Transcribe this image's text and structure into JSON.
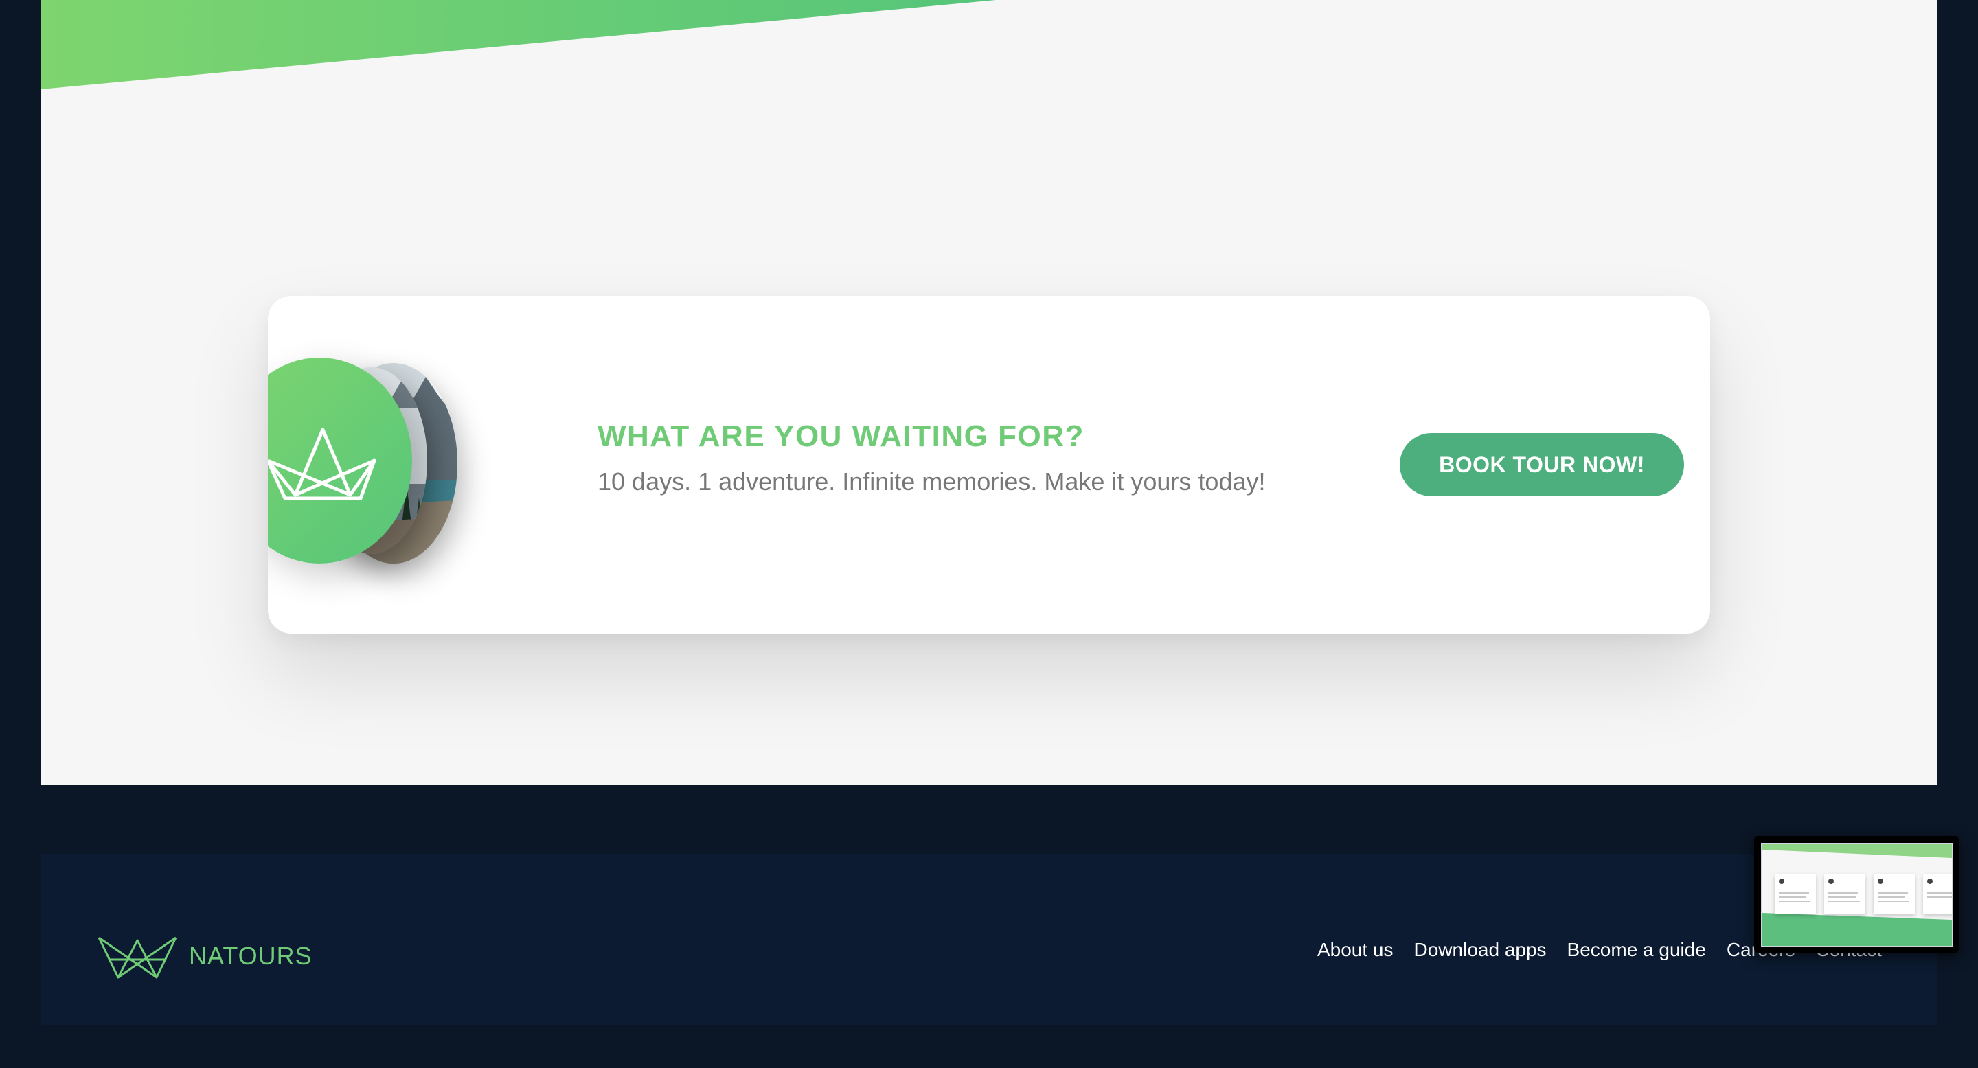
{
  "cta": {
    "title": "WHAT ARE YOU WAITING FOR?",
    "subtitle": "10 days. 1 adventure. Infinite memories. Make it yours today!",
    "button_label": "BOOK TOUR NOW!"
  },
  "footer": {
    "brand": "NATOURS",
    "links": [
      {
        "label": "About us"
      },
      {
        "label": "Download apps"
      },
      {
        "label": "Become a guide"
      },
      {
        "label": "Careers"
      },
      {
        "label": "Contact"
      }
    ]
  },
  "colors": {
    "accent_green": "#55c57a",
    "light_green": "#7ed56f",
    "button_green": "#4caf7d",
    "footer_bg": "#0c1b31",
    "page_bg": "#0b1626"
  },
  "icons": {
    "logo": "crown-logo-icon",
    "preview": "page-preview-thumbnail"
  }
}
